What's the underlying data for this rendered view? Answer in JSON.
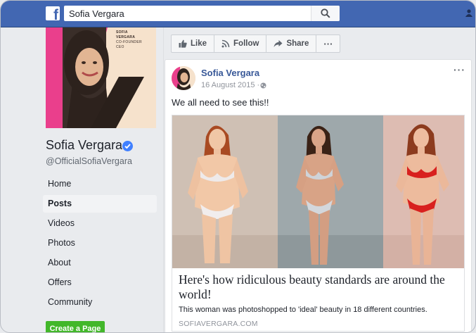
{
  "colors": {
    "facebook_blue": "#4267b2",
    "link_blue": "#385898",
    "verified_blue": "#4080ff",
    "green": "#42b72a"
  },
  "topbar": {
    "logo": "f",
    "logo_icon": "facebook-logo",
    "search_value": "Sofia Vergara",
    "search_icon": "magnifier"
  },
  "page": {
    "name": "Sofia Vergara",
    "verified_icon": "verified-check",
    "handle": "@OfficialSofiaVergara",
    "cover_text": [
      "SOFIA",
      "VERGARA",
      "CO-FOUNDER",
      "CEO"
    ]
  },
  "nav": {
    "items": [
      "Home",
      "Posts",
      "Videos",
      "Photos",
      "About",
      "Offers",
      "Community"
    ],
    "active": "Posts"
  },
  "create_page": "Create a Page",
  "actions": {
    "like": "Like",
    "follow": "Follow",
    "share": "Share",
    "more": "···"
  },
  "post": {
    "author": "Sofia Vergara",
    "date": "16 August 2015",
    "separator": "·",
    "privacy_icon": "globe",
    "more": "···",
    "text": "We all need to see this!!",
    "link": {
      "title": "Here's how ridiculous beauty standards are around the world!",
      "description": "This woman was photoshopped to 'ideal' beauty in 18 different countries.",
      "domain": "SOFIAVERGARA.COM"
    }
  }
}
